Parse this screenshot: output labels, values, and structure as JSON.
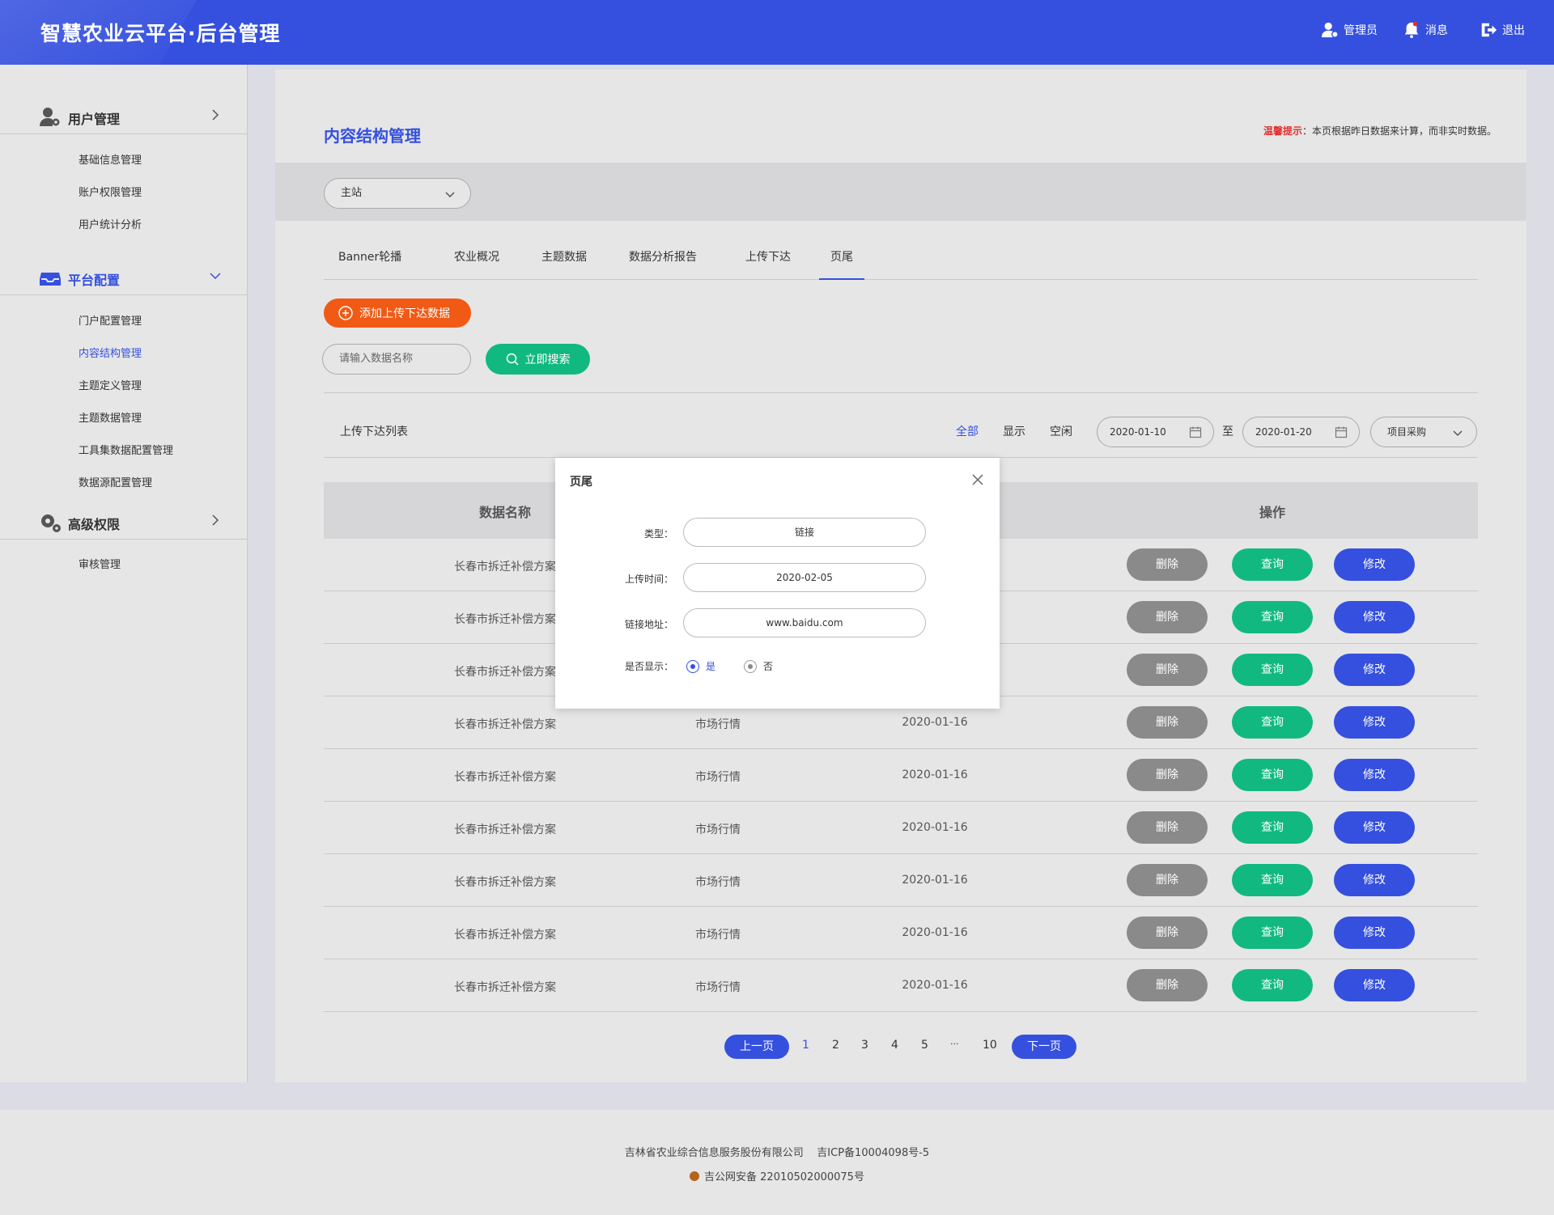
{
  "header": {
    "title": "智慧农业云平台·后台管理",
    "admin_label": "管理员",
    "messages_label": "消息",
    "logout_label": "退出"
  },
  "sidebar": {
    "sections": [
      {
        "label": "用户管理",
        "icon": "user-gear-icon",
        "items": [
          "基础信息管理",
          "账户权限管理",
          "用户统计分析"
        ]
      },
      {
        "label": "平台配置",
        "icon": "inbox-icon",
        "items": [
          "门户配置管理",
          "内容结构管理",
          "主题定义管理",
          "主题数据管理",
          "工具集数据配置管理",
          "数据源配置管理"
        ]
      },
      {
        "label": "高级权限",
        "icon": "gears-icon",
        "items": [
          "审核管理"
        ]
      }
    ],
    "active_item": "内容结构管理"
  },
  "main": {
    "title": "内容结构管理",
    "tip_prefix": "温馨提示",
    "tip_text": "：本页根据昨日数据来计算，而非实时数据。",
    "site_select": "主站",
    "tabs": [
      "Banner轮播",
      "农业概况",
      "主题数据",
      "数据分析报告",
      "上传下达",
      "页尾"
    ],
    "active_tab": "页尾",
    "add_button": "添加上传下达数据",
    "search_placeholder": "请输入数据名称",
    "search_button": "立即搜索",
    "list_title": "上传下达列表",
    "filters": [
      "全部",
      "显示",
      "空闲"
    ],
    "date_from": "2020-01-10",
    "date_sep": "至",
    "date_to": "2020-01-20",
    "project_select": "项目采购",
    "table": {
      "headers": [
        "数据名称",
        "操作"
      ],
      "rows": [
        {
          "name": "长春市拆迁补偿方案",
          "type": "",
          "date": ""
        },
        {
          "name": "长春市拆迁补偿方案",
          "type": "",
          "date": ""
        },
        {
          "name": "长春市拆迁补偿方案",
          "type": "",
          "date": ""
        },
        {
          "name": "长春市拆迁补偿方案",
          "type": "市场行情",
          "date": "2020-01-16"
        },
        {
          "name": "长春市拆迁补偿方案",
          "type": "市场行情",
          "date": "2020-01-16"
        },
        {
          "name": "长春市拆迁补偿方案",
          "type": "市场行情",
          "date": "2020-01-16"
        },
        {
          "name": "长春市拆迁补偿方案",
          "type": "市场行情",
          "date": "2020-01-16"
        },
        {
          "name": "长春市拆迁补偿方案",
          "type": "市场行情",
          "date": "2020-01-16"
        },
        {
          "name": "长春市拆迁补偿方案",
          "type": "市场行情",
          "date": "2020-01-16"
        }
      ],
      "actions": {
        "delete": "删除",
        "query": "查询",
        "edit": "修改"
      }
    },
    "pagination": {
      "prev": "上一页",
      "pages": [
        "1",
        "2",
        "3",
        "4",
        "5",
        "···",
        "10"
      ],
      "next": "下一页",
      "current": "1"
    }
  },
  "dialog": {
    "title": "页尾",
    "fields": [
      {
        "label": "类型：",
        "value": "链接"
      },
      {
        "label": "上传时间：",
        "value": "2020-02-05"
      },
      {
        "label": "链接地址：",
        "value": "www.baidu.com"
      }
    ],
    "display_label": "是否显示：",
    "options": [
      "是",
      "否"
    ],
    "selected": "是"
  },
  "footer": {
    "line1": "吉林省农业综合信息服务股份有限公司    吉ICP备10004098号-5",
    "line2": "吉公网安备 22010502000075号"
  },
  "colors": {
    "primary": "#3550de",
    "accent_orange": "#f05a15",
    "green": "#11b981",
    "gray_button": "#8a8a8a",
    "warning_red": "#e23030"
  }
}
